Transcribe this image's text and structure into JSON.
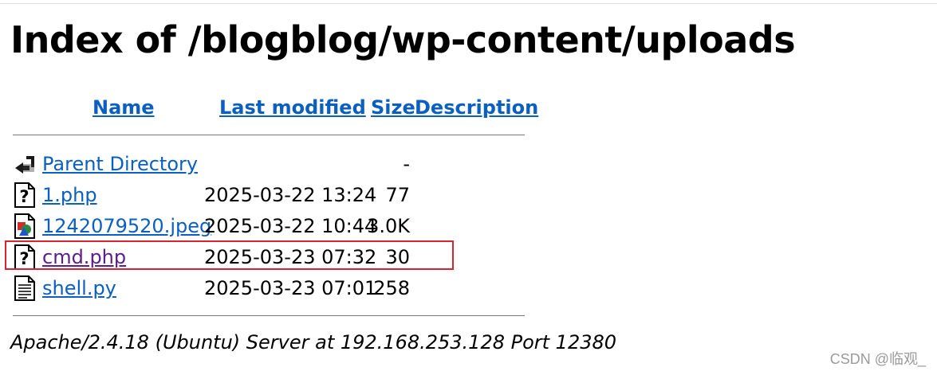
{
  "page": {
    "title": "Index of /blogblog/wp-content/uploads"
  },
  "table": {
    "headers": {
      "name": "Name",
      "last_modified": "Last modified",
      "size": "Size",
      "description": "Description"
    },
    "rows": [
      {
        "icon": "back-icon",
        "name": "Parent Directory",
        "date": "",
        "size": "-",
        "highlighted": false,
        "visited": false
      },
      {
        "icon": "unknown-file-icon",
        "name": "1.php",
        "date": "2025-03-22 13:24",
        "size": "77",
        "highlighted": false,
        "visited": false
      },
      {
        "icon": "image-file-icon",
        "name": "1242079520.jpeg",
        "date": "2025-03-22 10:44",
        "size": "3.0K",
        "highlighted": false,
        "visited": false
      },
      {
        "icon": "unknown-file-icon",
        "name": "cmd.php",
        "date": "2025-03-23 07:32",
        "size": "30",
        "highlighted": true,
        "visited": true
      },
      {
        "icon": "text-file-icon",
        "name": "shell.py",
        "date": "2025-03-23 07:01",
        "size": "258",
        "highlighted": false,
        "visited": false
      }
    ]
  },
  "footer": {
    "server_signature": "Apache/2.4.18 (Ubuntu) Server at 192.168.253.128 Port 12380"
  },
  "watermark": "CSDN @临观_",
  "colors": {
    "link": "#0b5fc0",
    "visited_link": "#5b1d8a",
    "highlight_border": "#d9232e"
  }
}
